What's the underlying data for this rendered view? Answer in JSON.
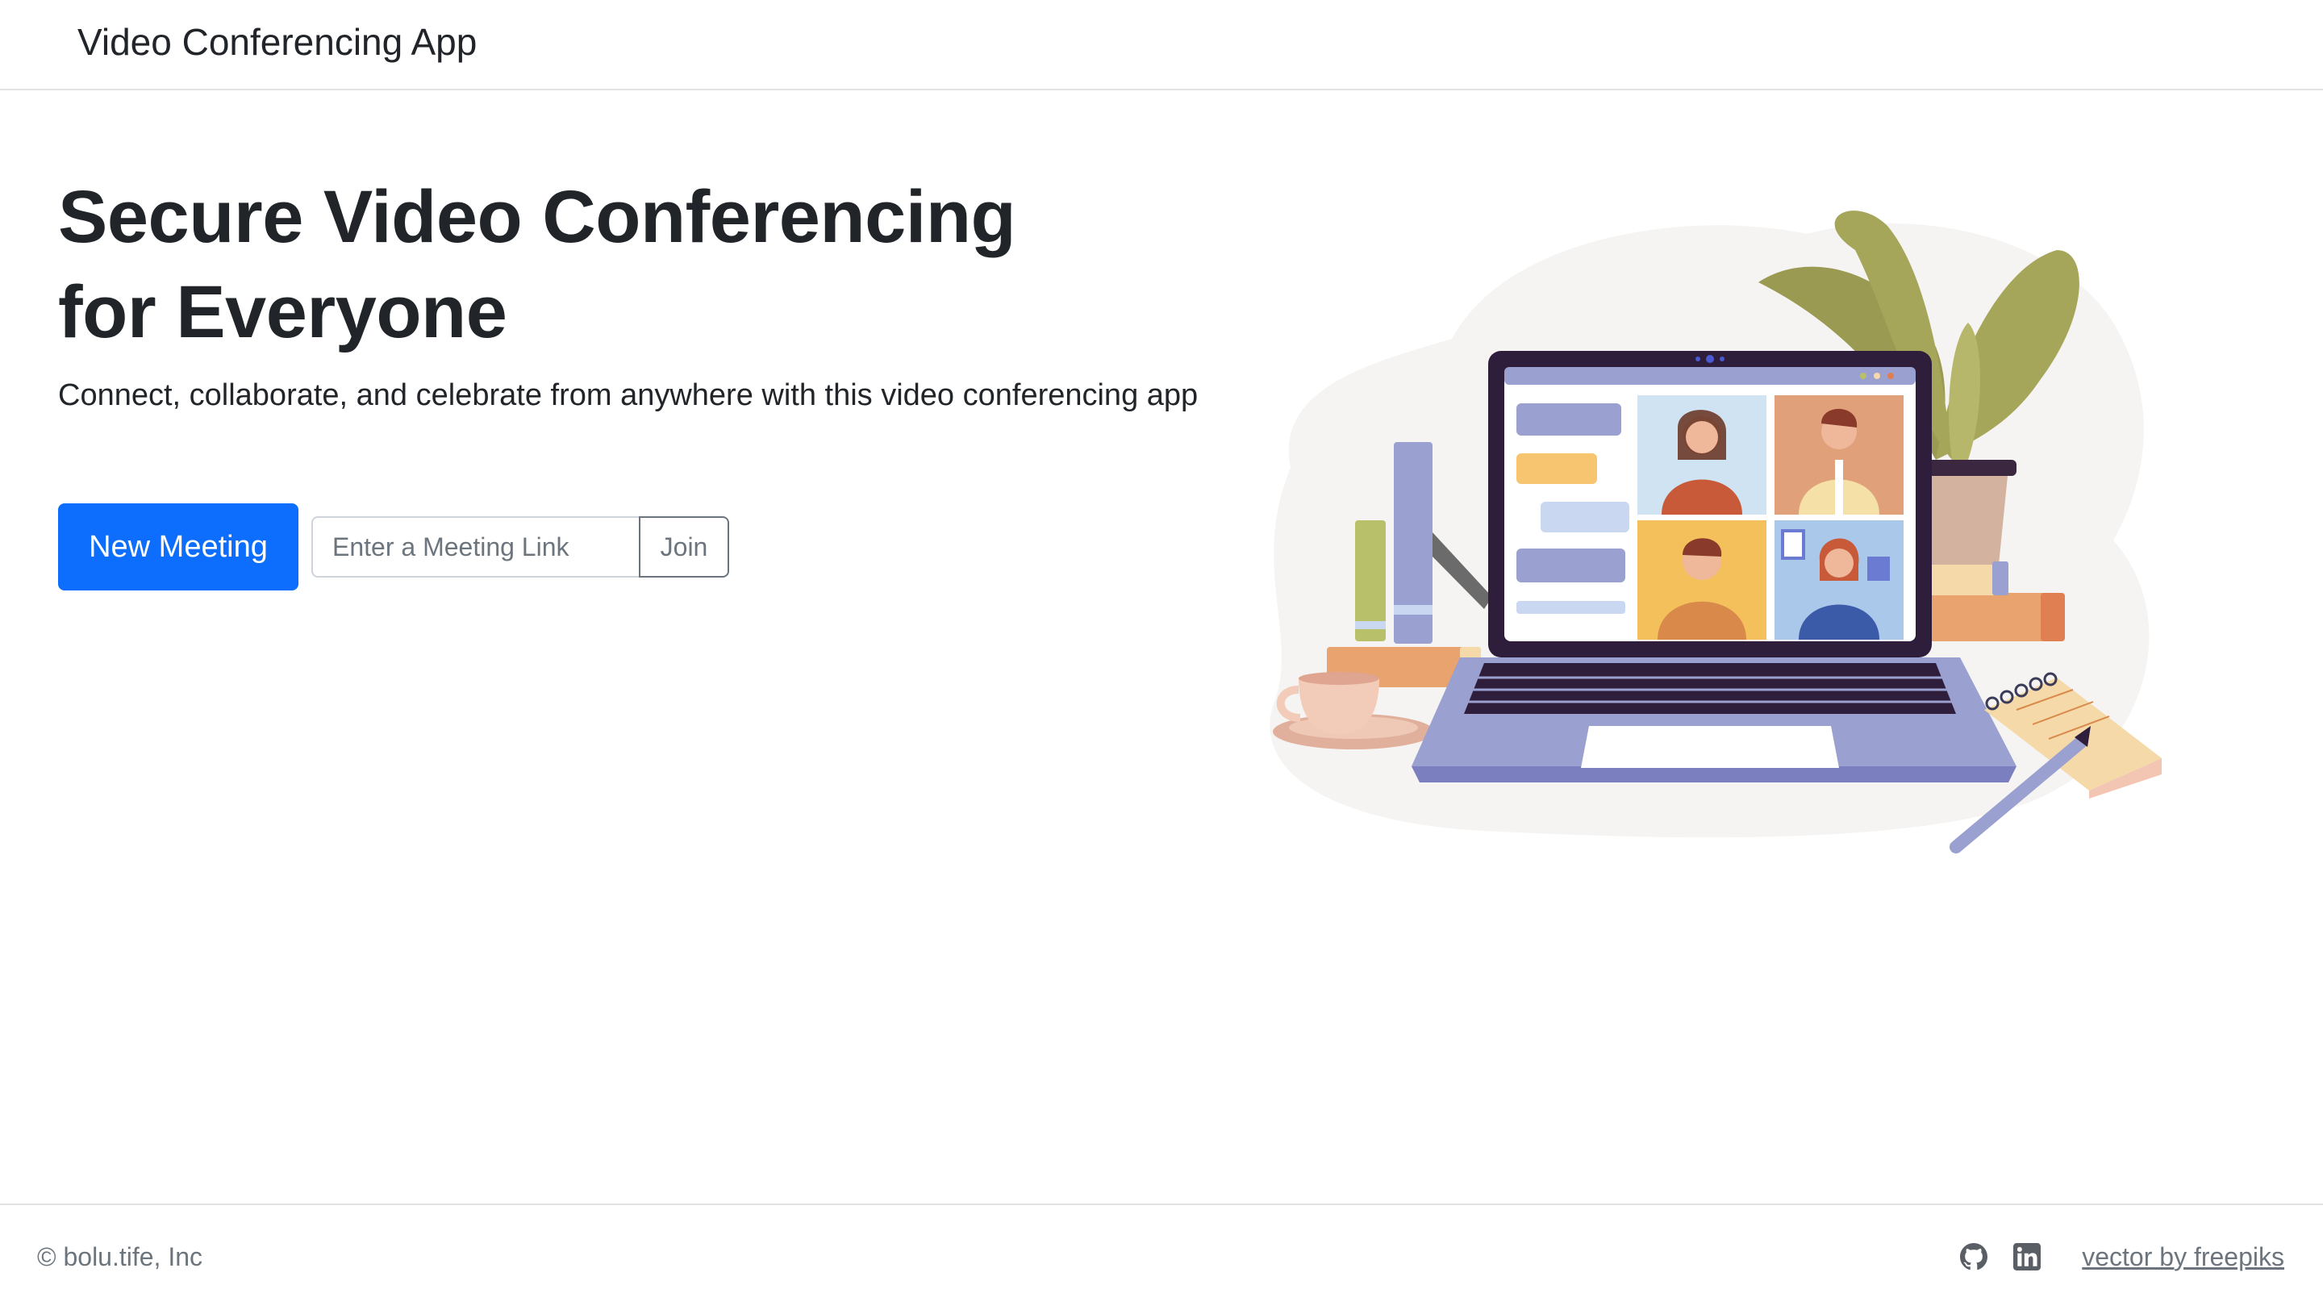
{
  "navbar": {
    "brand": "Video Conferencing App"
  },
  "hero": {
    "title_line1": "Secure Video Conferencing",
    "title_line2": "for Everyone",
    "subtitle": "Connect, collaborate, and celebrate from anywhere with this video conferencing app",
    "new_meeting_label": "New Meeting",
    "link_placeholder": "Enter a Meeting Link",
    "join_label": "Join"
  },
  "footer": {
    "copyright": "© bolu.tife, Inc",
    "icons": [
      "github-icon",
      "linkedin-icon"
    ],
    "credit": "vector by freepiks"
  },
  "colors": {
    "primary": "#0d6efd",
    "text": "#212529",
    "muted": "#6c757d",
    "border": "#e3e3e3"
  }
}
